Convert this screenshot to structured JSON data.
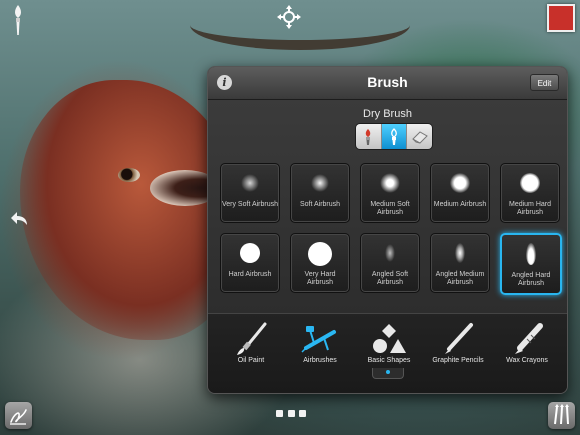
{
  "panel": {
    "title": "Brush",
    "edit_label": "Edit",
    "info_icon": "i",
    "brush_type": "Dry Brush"
  },
  "segments": [
    {
      "icon": "wet-brush-icon",
      "active": false
    },
    {
      "icon": "dry-brush-icon",
      "active": true
    },
    {
      "icon": "eraser-icon",
      "active": false
    }
  ],
  "brushes": [
    {
      "label": "Very Soft Airbrush",
      "selected": false
    },
    {
      "label": "Soft Airbrush",
      "selected": false
    },
    {
      "label": "Medium Soft Airbrush",
      "selected": false
    },
    {
      "label": "Medium Airbrush",
      "selected": false
    },
    {
      "label": "Medium Hard Airbrush",
      "selected": false
    },
    {
      "label": "Hard Airbrush",
      "selected": false
    },
    {
      "label": "Very Hard Airbrush",
      "selected": false
    },
    {
      "label": "Angled Soft Airbrush",
      "selected": false
    },
    {
      "label": "Angled Medium Airbrush",
      "selected": false
    },
    {
      "label": "Angled Hard Airbrush",
      "selected": true
    }
  ],
  "tools": [
    {
      "label": "Oil Paint",
      "icon": "oil-paint-brush-icon",
      "active": false
    },
    {
      "label": "Airbrushes",
      "icon": "airbrush-icon",
      "active": true
    },
    {
      "label": "Basic Shapes",
      "icon": "basic-shapes-icon",
      "active": false
    },
    {
      "label": "Graphite Pencils",
      "icon": "graphite-pencil-icon",
      "active": false
    },
    {
      "label": "Wax Crayons",
      "icon": "wax-crayon-icon",
      "active": false
    }
  ],
  "colors": {
    "accent": "#29b6f0",
    "current_color": "#c8302a"
  }
}
